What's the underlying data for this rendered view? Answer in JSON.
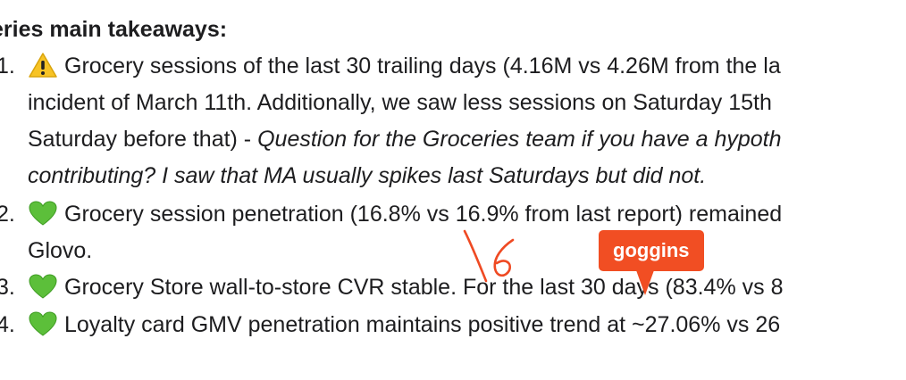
{
  "document": {
    "heading": "eries main takeaways:",
    "items": [
      {
        "number": "1.",
        "icon": "warning-icon",
        "line1": "Grocery sessions of the last 30 trailing days (4.16M vs 4.26M from the la",
        "line2": "incident of March 11th. Additionally, we saw less sessions on  Saturday 15th",
        "line3_plain": "Saturday before that) - ",
        "line3_italic": "Question for the Groceries team if you have a hypoth",
        "line4_italic": "contributing? I saw that MA usually spikes last Saturdays but did not."
      },
      {
        "number": "2.",
        "icon": "green-heart-icon",
        "line1": "Grocery session penetration (16.8% vs 16.9% from last report) remained",
        "line2": "Glovo."
      },
      {
        "number": "3.",
        "icon": "green-heart-icon",
        "line1": "Grocery Store wall-to-store CVR stable. For the last 30 days (83.4% vs 8"
      },
      {
        "number": "4.",
        "icon": "green-heart-icon",
        "line1": "Loyalty card GMV penetration maintains positive trend at ~27.06% vs 26"
      }
    ]
  },
  "annotation": {
    "tag_label": "goggins",
    "tag_color": "#f14e23",
    "scribble_color": "#ef4a23"
  }
}
